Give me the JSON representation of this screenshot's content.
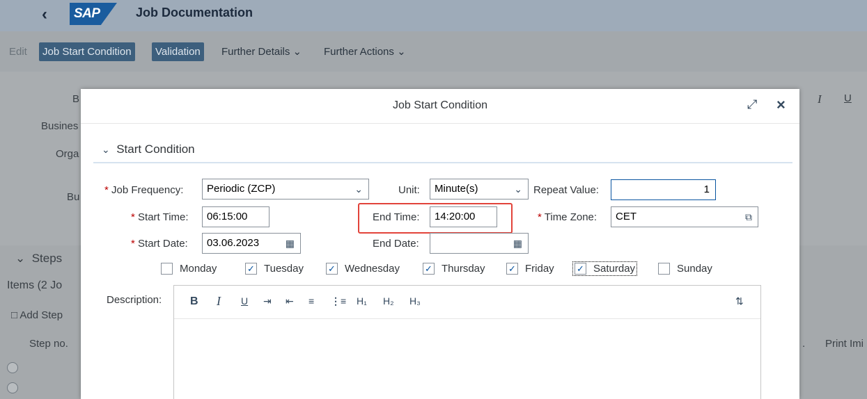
{
  "shell": {
    "back_icon": "chevron-left-icon",
    "logo_text": "SAP",
    "title": "Job Documentation"
  },
  "toolbar": {
    "edit": "Edit",
    "job_start_condition": "Job Start Condition",
    "validation": "Validation",
    "further_details": "Further Details",
    "further_actions": "Further Actions"
  },
  "background": {
    "labels": [
      "B",
      "Busines",
      "Orga",
      "Bu"
    ],
    "steps_title": "Steps",
    "items_title": "Items (2 Jo",
    "add_step": "Add Step",
    "step_no": "Step no.",
    "print_col": "Print Imi",
    "col_dot": "."
  },
  "dialog": {
    "title": "Job Start Condition",
    "section_title": "Start Condition",
    "job_frequency_label": "Job Frequency:",
    "job_frequency_value": "Periodic (ZCP)",
    "unit_label": "Unit:",
    "unit_value": "Minute(s)",
    "repeat_value_label": "Repeat Value:",
    "repeat_value": "1",
    "start_time_label": "Start Time:",
    "start_time_value": "06:15:00",
    "end_time_label": "End Time:",
    "end_time_value": "14:20:00",
    "time_zone_label": "Time Zone:",
    "time_zone_value": "CET",
    "start_date_label": "Start Date:",
    "start_date_value": "03.06.2023",
    "end_date_label": "End Date:",
    "end_date_value": "",
    "days": [
      {
        "label": "Monday",
        "checked": false
      },
      {
        "label": "Tuesday",
        "checked": true
      },
      {
        "label": "Wednesday",
        "checked": true
      },
      {
        "label": "Thursday",
        "checked": true
      },
      {
        "label": "Friday",
        "checked": true
      },
      {
        "label": "Saturday",
        "checked": true
      },
      {
        "label": "Sunday",
        "checked": false
      }
    ],
    "description_label": "Description:",
    "editor_tools": {
      "bold": "B",
      "italic": "I",
      "underline": "U",
      "h1": "H₁",
      "h2": "H₂",
      "h3": "H₃"
    }
  },
  "colors": {
    "accent": "#0854a0",
    "required": "#bb0000",
    "highlight": "#e2433a"
  }
}
